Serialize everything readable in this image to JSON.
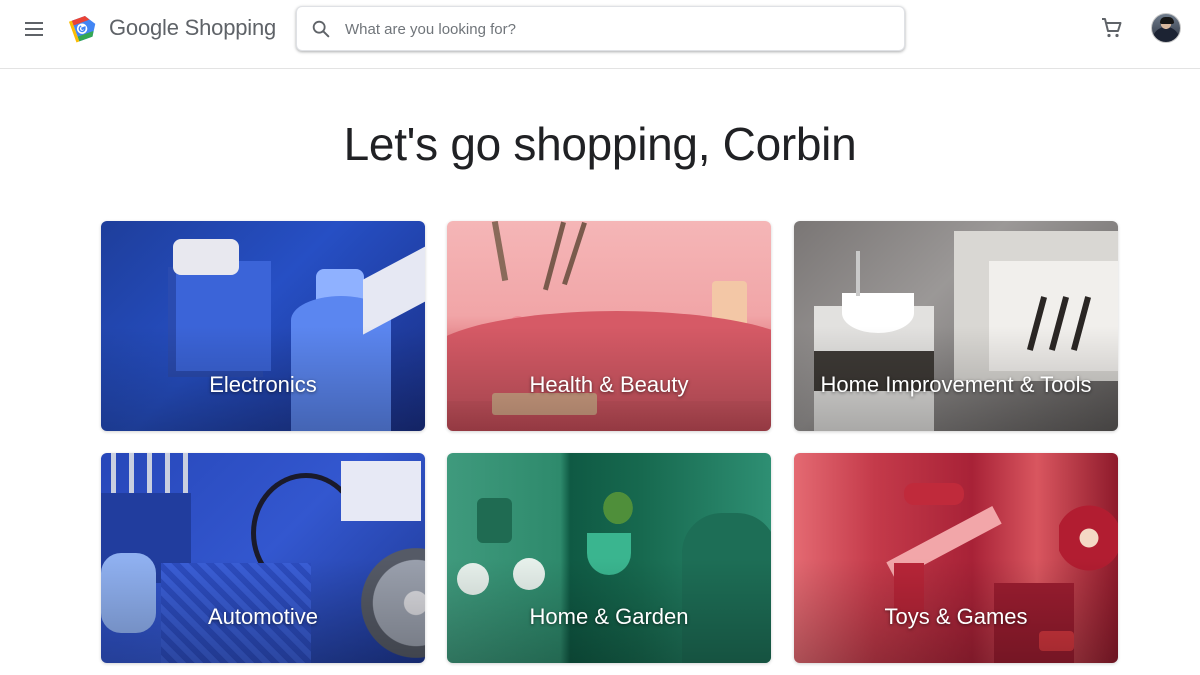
{
  "header": {
    "logo_text": "Google Shopping",
    "search_placeholder": "What are you looking for?",
    "search_value": ""
  },
  "main": {
    "greeting": "Let's go shopping, Corbin"
  },
  "categories": [
    {
      "label": "Electronics"
    },
    {
      "label": "Health & Beauty"
    },
    {
      "label": "Home Improvement & Tools"
    },
    {
      "label": "Automotive"
    },
    {
      "label": "Home & Garden"
    },
    {
      "label": "Toys & Games"
    }
  ],
  "icons": {
    "menu": "menu-icon",
    "logo": "google-shopping-tag-icon",
    "search": "search-icon",
    "cart": "shopping-cart-icon"
  },
  "colors": {
    "google_blue": "#4285f4",
    "google_red": "#ea4335",
    "google_yellow": "#fbbc04",
    "google_green": "#34a853",
    "text_dark": "#202124",
    "text_muted": "#5f6368"
  }
}
